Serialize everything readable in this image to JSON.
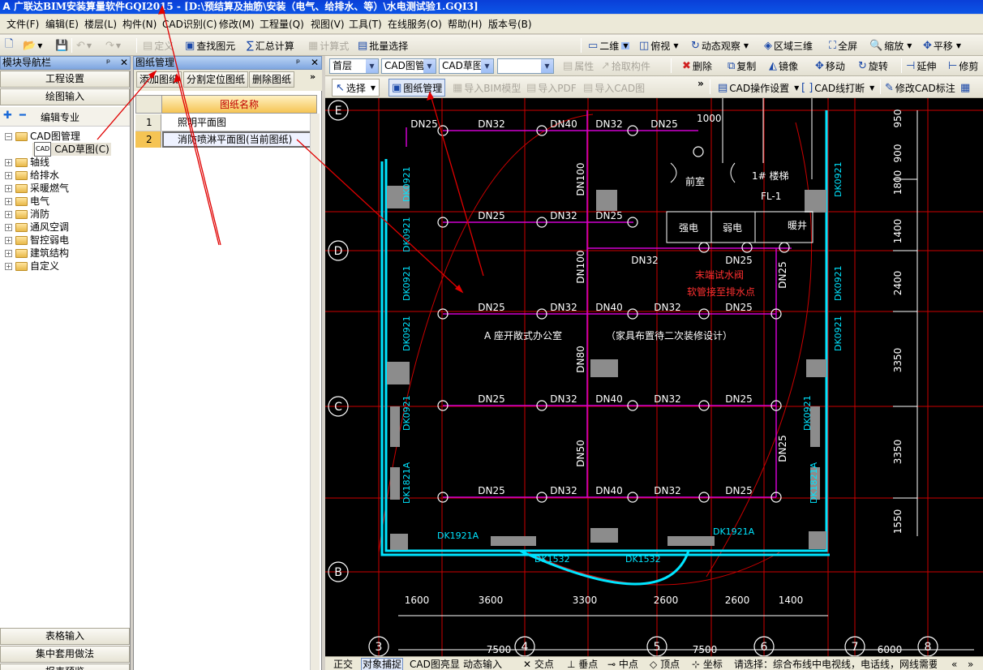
{
  "window": {
    "title": "广联达BIM安装算量软件GQI2015 - [D:\\预结算及抽筋\\安装（电气、给排水、等）\\水电测试验1.GQI3]"
  },
  "menu": [
    "文件(F)",
    "编辑(E)",
    "楼层(L)",
    "构件(N)",
    "CAD识别(C)",
    "修改(M)",
    "工程量(Q)",
    "视图(V)",
    "工具(T)",
    "在线服务(O)",
    "帮助(H)",
    "版本号(B)"
  ],
  "toolbar1": {
    "define": "定义",
    "find_element": "查找图元",
    "summary_calc": "汇总计算",
    "calc_formula": "计算式",
    "batch_select": "批量选择",
    "view_mode": "二维",
    "top_view": "俯视",
    "dynamic_view": "动态观察",
    "region_3d": "区域三维",
    "fullscreen": "全屏",
    "zoom": "缩放",
    "pan": "平移"
  },
  "toolbar2": {
    "floor": "首层",
    "cad_manage": "CAD图管理",
    "cad_sketch": "CAD草图",
    "layer_empty": "",
    "properties": "属性",
    "pick_component": "拾取构件",
    "delete": "删除",
    "copy": "复制",
    "mirror": "镜像",
    "move": "移动",
    "rotate": "旋转",
    "extend": "延伸",
    "trim": "修剪"
  },
  "toolbar3": {
    "select": "选择",
    "drawing_manage": "图纸管理",
    "import_bim": "导入BIM模型",
    "import_pdf": "导入PDF",
    "import_cad": "导入CAD图",
    "cad_settings": "CAD操作设置",
    "cad_line_break": "CAD线打断",
    "modify_cad_label": "修改CAD标注"
  },
  "nav_panel": {
    "title": "模块导航栏",
    "project_settings": "工程设置",
    "drawing_input": "绘图输入",
    "edit_specialty": "编辑专业",
    "tree": [
      {
        "label": "CAD图管理",
        "expanded": true,
        "children": [
          {
            "label": "CAD草图(C)"
          }
        ]
      },
      {
        "label": "轴线"
      },
      {
        "label": "给排水"
      },
      {
        "label": "采暖燃气"
      },
      {
        "label": "电气"
      },
      {
        "label": "消防"
      },
      {
        "label": "通风空调"
      },
      {
        "label": "智控弱电"
      },
      {
        "label": "建筑结构"
      },
      {
        "label": "自定义"
      }
    ],
    "table_input": "表格输入",
    "centralized_method": "集中套用做法",
    "report_preview": "报表预览"
  },
  "drawing_panel": {
    "title": "图纸管理",
    "add_drawing": "添加图纸",
    "split_drawing": "分割定位图纸",
    "delete_drawing": "删除图纸",
    "column_header": "图纸名称",
    "rows": [
      {
        "index": "1",
        "name": "照明平面图"
      },
      {
        "index": "2",
        "name": "消防喷淋平面图(当前图纸)"
      }
    ]
  },
  "cad": {
    "axes_left": [
      "E",
      "D",
      "C",
      "B"
    ],
    "axes_bottom": [
      "3",
      "4",
      "5",
      "6",
      "7",
      "8"
    ],
    "right_dims": [
      "950",
      "900",
      "1800",
      "1400",
      "2400",
      "3350",
      "3350",
      "1550"
    ],
    "bottom_dims": [
      "1600",
      "3600",
      "3300",
      "2600",
      "2600",
      "1400"
    ],
    "bottom_dims2": [
      "7500",
      "7500",
      "6000"
    ],
    "row_labels": [
      [
        "DN25",
        "DN32",
        "DN40",
        "DN32",
        "DN25"
      ],
      [
        "DN25",
        "DN32",
        "DN25"
      ],
      [
        "DN25",
        "DN32",
        "DN40",
        "DN32",
        "DN25"
      ],
      [
        "DN25",
        "DN32",
        "DN40",
        "DN32",
        "DN25"
      ],
      [
        "DN25",
        "DN32",
        "DN40",
        "DN32",
        "DN25"
      ]
    ],
    "riser_labels": [
      "DN100",
      "DN100",
      "DN80",
      "DN50"
    ],
    "dn32_mid": "DN32",
    "dn25_right": "DN25",
    "dn25_vert1": "DN25",
    "dn25_vert2": "DN25",
    "room_1000": "1000",
    "room_vestibule": "前室",
    "room_stair": "1# 楼梯",
    "room_fl": "FL-1",
    "room_strong": "强电",
    "room_weak": "弱电",
    "room_heat": "暖井",
    "office_label": "A 座开敞式办公室",
    "office_note": "（家具布置待二次装修设计）",
    "red_note1": "末端试水阀",
    "red_note2": "软管接至排水点",
    "wall_labels": [
      "DK0921",
      "DK0921",
      "DK0921",
      "DK0921",
      "DK0921",
      "DK0921",
      "DK0921",
      "DK0921",
      "DK0921"
    ],
    "door_labels": [
      "DK1821A",
      "DK1821A",
      "DK1921A",
      "DK1921A",
      "DK1532",
      "DK1532"
    ]
  },
  "statusbar": {
    "items": [
      "正交",
      "对象捕捉",
      "CAD图亮显",
      "动态输入",
      "交点",
      "垂点",
      "中点",
      "顶点",
      "坐标"
    ],
    "hint": "请选择：综合布线中电视线，电话线，网线需要"
  },
  "colors": {
    "cad_bg": "#000000",
    "wall_cyan": "#00e5ff",
    "pipe_magenta": "#d000d0",
    "grid_red": "#cc0000",
    "title_blue": "#0a3fd8"
  }
}
